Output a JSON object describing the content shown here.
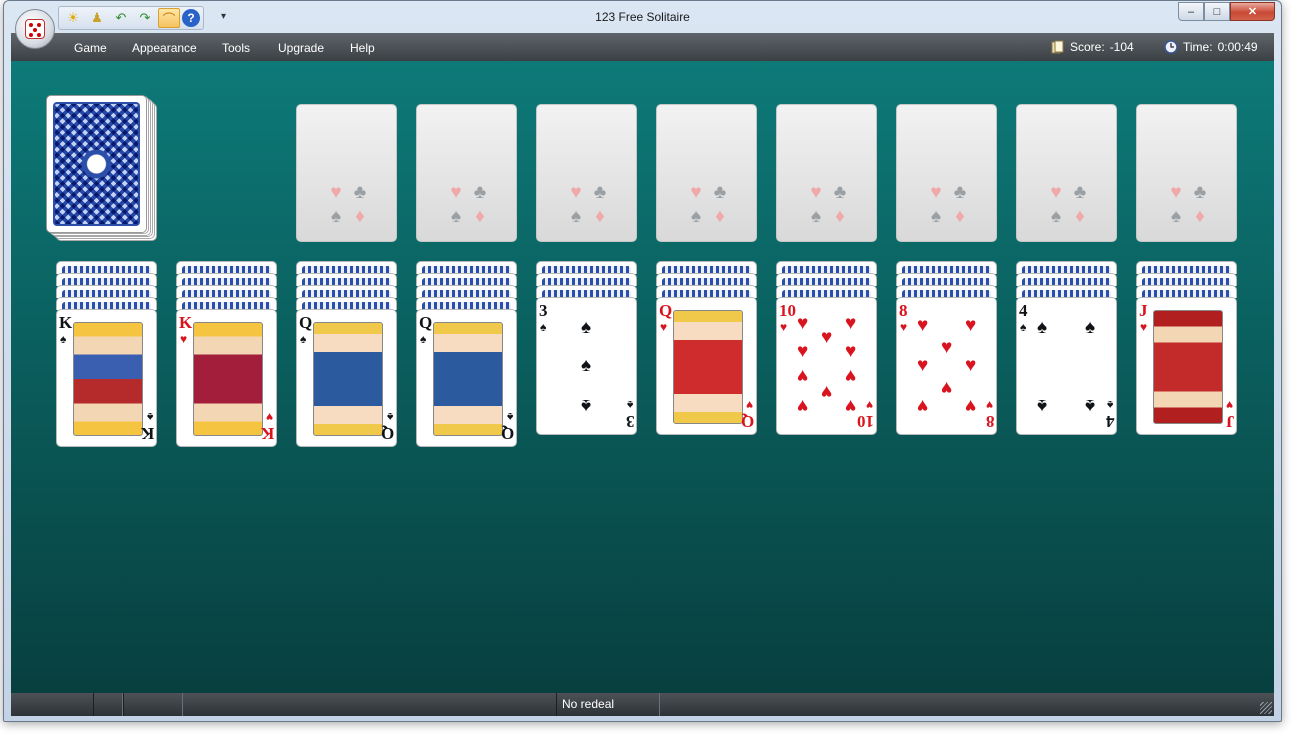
{
  "window": {
    "title": "123 Free Solitaire",
    "minimize": "–",
    "maximize": "□",
    "close": "✕"
  },
  "quick_access": [
    {
      "icon": "sun-icon",
      "glyph": "☀"
    },
    {
      "icon": "hint-icon",
      "glyph": "♟"
    },
    {
      "icon": "undo-icon",
      "glyph": "↶"
    },
    {
      "icon": "redo-icon",
      "glyph": "↷"
    },
    {
      "icon": "autoplay-icon",
      "glyph": "⌒"
    },
    {
      "icon": "help-icon",
      "glyph": "?"
    }
  ],
  "qat_dropdown": "▾",
  "menu": [
    "Game",
    "Appearance",
    "Tools",
    "Upgrade",
    "Help"
  ],
  "status": {
    "score_label": "Score:",
    "score_value": "-104",
    "time_label": "Time:",
    "time_value": "0:00:49"
  },
  "statusbar": {
    "message": "No redeal"
  },
  "foundations": [
    {
      "suits": [
        "♥",
        "♣",
        "♠",
        "♦"
      ]
    },
    {
      "suits": [
        "♥",
        "♣",
        "♠",
        "♦"
      ]
    },
    {
      "suits": [
        "♥",
        "♣",
        "♠",
        "♦"
      ]
    },
    {
      "suits": [
        "♥",
        "♣",
        "♠",
        "♦"
      ]
    },
    {
      "suits": [
        "♥",
        "♣",
        "♠",
        "♦"
      ]
    },
    {
      "suits": [
        "♥",
        "♣",
        "♠",
        "♦"
      ]
    },
    {
      "suits": [
        "♥",
        "♣",
        "♠",
        "♦"
      ]
    },
    {
      "suits": [
        "♥",
        "♣",
        "♠",
        "♦"
      ]
    }
  ],
  "tableau": [
    {
      "hidden": 4,
      "rank": "K",
      "suit": "♠",
      "color": "blk",
      "kind": "court-k"
    },
    {
      "hidden": 4,
      "rank": "K",
      "suit": "♥",
      "color": "red",
      "kind": "court-kh"
    },
    {
      "hidden": 4,
      "rank": "Q",
      "suit": "♠",
      "color": "blk",
      "kind": "court-q"
    },
    {
      "hidden": 4,
      "rank": "Q",
      "suit": "♠",
      "color": "blk",
      "kind": "court-q"
    },
    {
      "hidden": 3,
      "rank": "3",
      "suit": "♠",
      "color": "blk",
      "kind": "pip3"
    },
    {
      "hidden": 3,
      "rank": "Q",
      "suit": "♥",
      "color": "red",
      "kind": "court-qh"
    },
    {
      "hidden": 3,
      "rank": "10",
      "suit": "♥",
      "color": "red",
      "kind": "pip10"
    },
    {
      "hidden": 3,
      "rank": "8",
      "suit": "♥",
      "color": "red",
      "kind": "pip8"
    },
    {
      "hidden": 3,
      "rank": "4",
      "suit": "♠",
      "color": "blk",
      "kind": "pip4"
    },
    {
      "hidden": 3,
      "rank": "J",
      "suit": "♥",
      "color": "red",
      "kind": "court-j"
    }
  ]
}
